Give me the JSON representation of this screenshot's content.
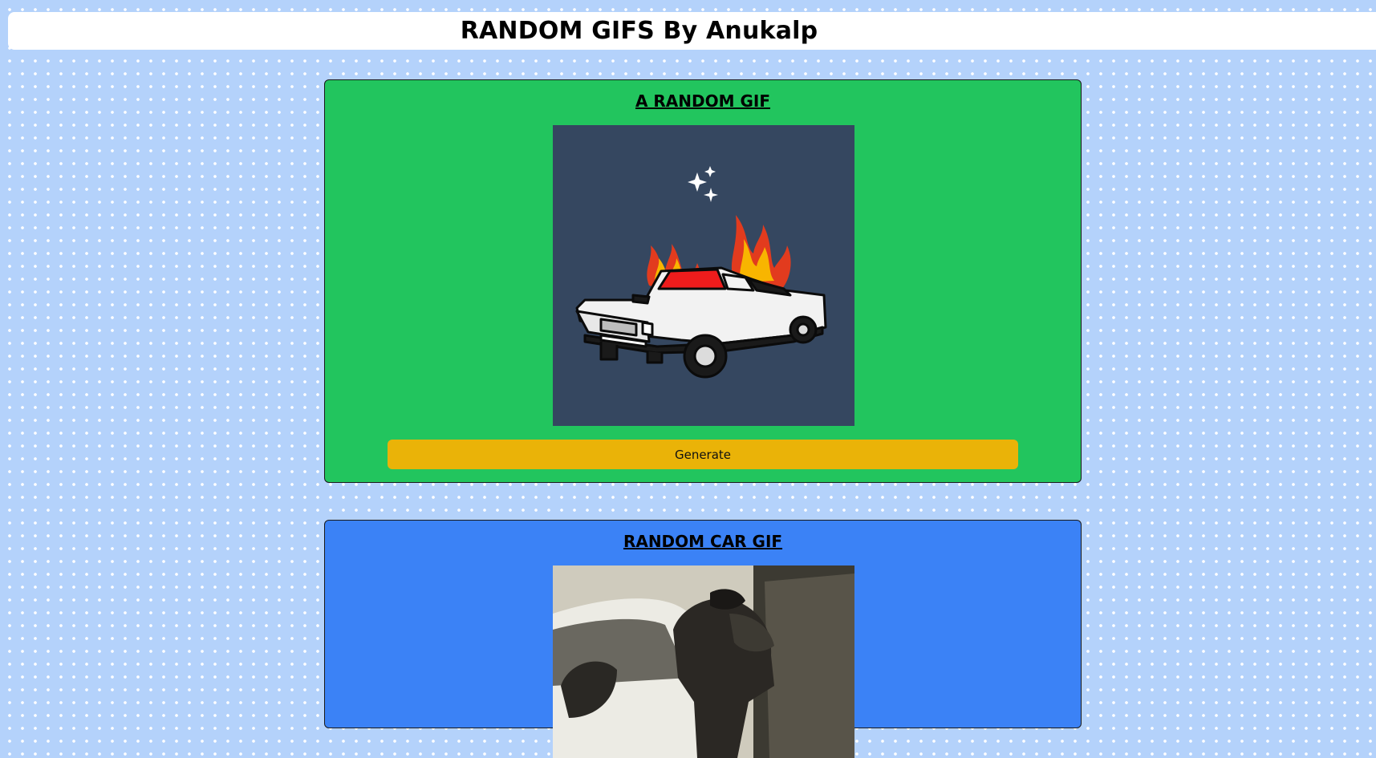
{
  "header": {
    "title": "RANDOM GIFS By Anukalp"
  },
  "colors": {
    "page_background": "#b4d2fb",
    "random_card": "#22c55e",
    "car_card": "#3b82f6",
    "generate_button": "#eab308",
    "gif_background": "#354760"
  },
  "random_card": {
    "title": "A RANDOM GIF",
    "gif_icon": "burning-car-illustration",
    "button_label": "Generate"
  },
  "car_card": {
    "title": "RANDOM CAR GIF",
    "gif_icon": "person-leaning-on-car-photo"
  }
}
